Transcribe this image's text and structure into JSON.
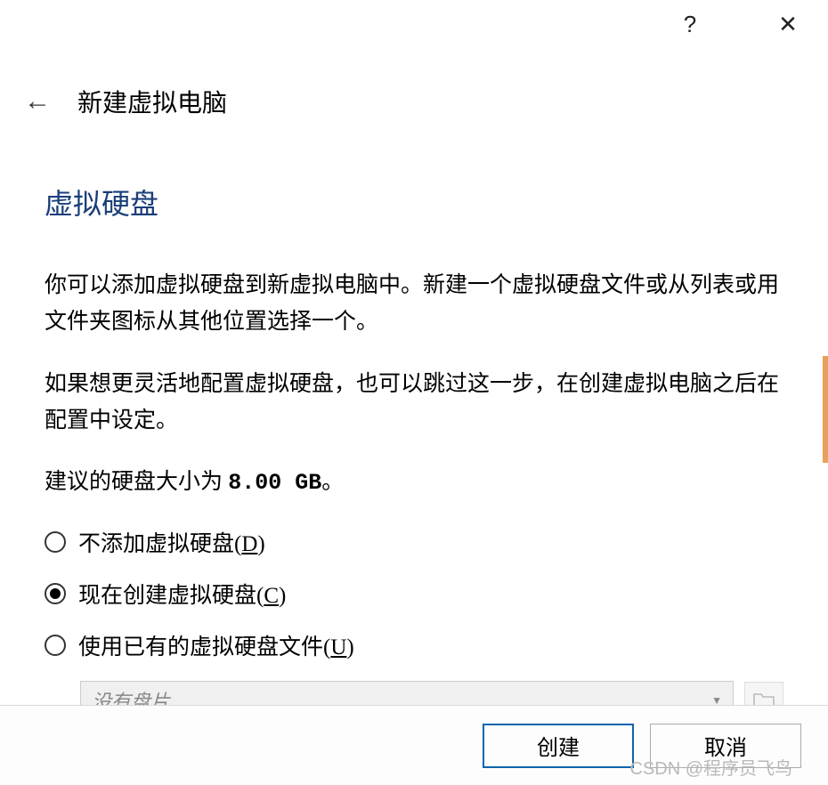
{
  "titlebar": {
    "help_symbol": "?",
    "close_symbol": "✕"
  },
  "header": {
    "back_symbol": "←",
    "title": "新建虚拟电脑"
  },
  "section": {
    "heading": "虚拟硬盘",
    "para1": "你可以添加虚拟硬盘到新虚拟电脑中。新建一个虚拟硬盘文件或从列表或用文件夹图标从其他位置选择一个。",
    "para2": "如果想更灵活地配置虚拟硬盘，也可以跳过这一步，在创建虚拟电脑之后在配置中设定。",
    "para3_prefix": "建议的硬盘大小为 ",
    "para3_size": "8.00 GB",
    "para3_suffix": "。"
  },
  "radios": {
    "opt1": {
      "label_before": "不添加虚拟硬盘(",
      "hotkey": "D",
      "label_after": ")",
      "selected": false
    },
    "opt2": {
      "label_before": "现在创建虚拟硬盘(",
      "hotkey": "C",
      "label_after": ")",
      "selected": true
    },
    "opt3": {
      "label_before": "使用已有的虚拟硬盘文件(",
      "hotkey": "U",
      "label_after": ")",
      "selected": false
    }
  },
  "combo": {
    "placeholder": "没有盘片",
    "arrow": "▼"
  },
  "footer": {
    "create_label": "创建",
    "cancel_label": "取消"
  },
  "watermark": "CSDN @程序员飞鸟"
}
